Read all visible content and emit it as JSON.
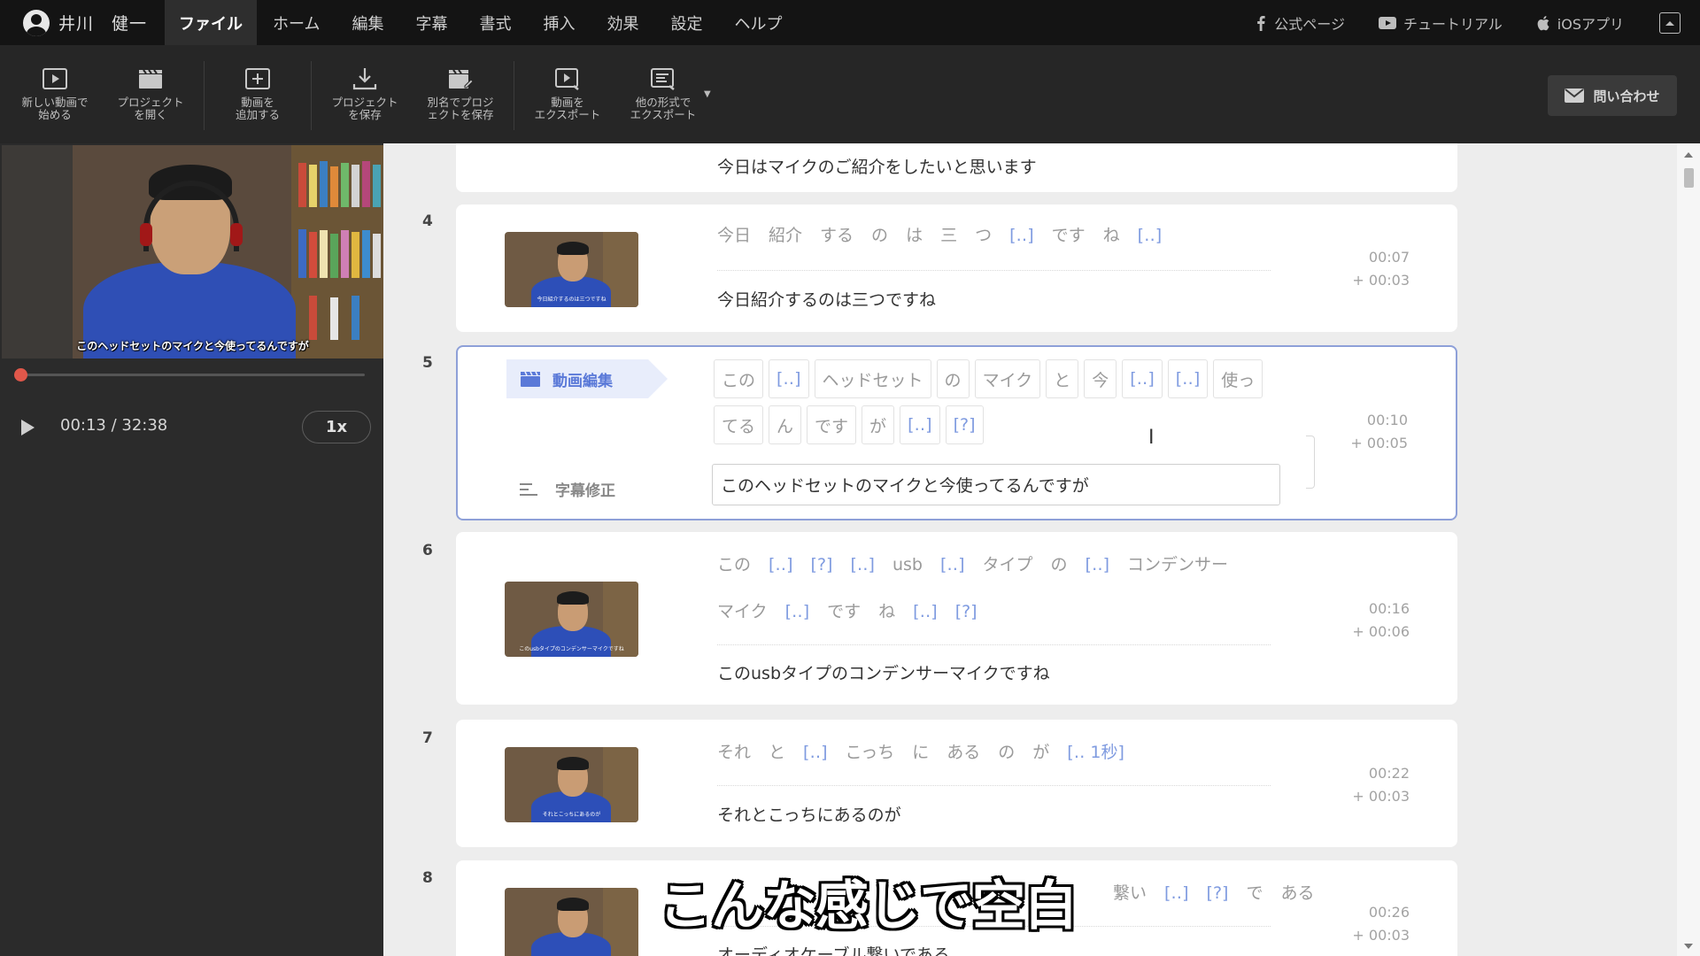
{
  "user": {
    "name": "井川　健一"
  },
  "menu": [
    "ファイル",
    "ホーム",
    "編集",
    "字幕",
    "書式",
    "挿入",
    "効果",
    "設定",
    "ヘルプ"
  ],
  "links": {
    "official": "公式ページ",
    "tutorial": "チュートリアル",
    "ios": "iOSアプリ"
  },
  "toolbar": {
    "new_video": "新しい動画で\n始める",
    "open_project": "プロジェクト\nを開く",
    "add_video": "動画を\n追加する",
    "save_project": "プロジェクト\nを保存",
    "save_as": "別名でプロジ\nェクトを保存",
    "export_video": "動画を\nエクスポート",
    "export_other": "他の形式で\nエクスポート",
    "contact": "問い合わせ"
  },
  "player": {
    "caption": "このヘッドセットのマイクと今使ってるんですが",
    "timecode": "00:13 / 32:38",
    "speed": "1x",
    "progress": 0.007
  },
  "rows": {
    "r3": {
      "subtitle": "今日はマイクのご紹介をしたいと思います"
    },
    "r4": {
      "num": "4",
      "words": [
        "今日",
        "紹介",
        "する",
        "の",
        "は",
        "三",
        "つ",
        "[‥]",
        "です",
        "ね",
        "[‥]"
      ],
      "subtitle": "今日紹介するのは三つですね",
      "time": "00:07",
      "dur": "+ 00:03",
      "thumb_caption": "今日紹介するのは三つですね"
    },
    "r5": {
      "num": "5",
      "chips1": [
        "この",
        "[‥]",
        "ヘッドセット",
        "の",
        "マイク",
        "と",
        "今",
        "[‥]",
        "[‥]",
        "使っ"
      ],
      "chips2": [
        "てる",
        "ん",
        "です",
        "が",
        "[‥]",
        "[?]"
      ],
      "edit_tag": "動画編集",
      "fix_label": "字幕修正",
      "input_value": "このヘッドセットのマイクと今使ってるんですが",
      "time": "00:10",
      "dur": "+ 00:05"
    },
    "r6": {
      "num": "6",
      "words1": [
        "この",
        "[‥]",
        "[?]",
        "[‥]",
        "usb",
        "[‥]",
        "タイプ",
        "の",
        "[‥]",
        "コンデンサー"
      ],
      "words2": [
        "マイク",
        "[‥]",
        "です",
        "ね",
        "[‥]",
        "[?]"
      ],
      "subtitle": "このusbタイプのコンデンサーマイクですね",
      "time": "00:16",
      "dur": "+ 00:06",
      "thumb_caption": "このusbタイプのコンデンサーマイクですね"
    },
    "r7": {
      "num": "7",
      "words": [
        "それ",
        "と",
        "[‥]",
        "こっち",
        "に",
        "ある",
        "の",
        "が",
        "[‥ 1秒]"
      ],
      "subtitle": "それとこっちにあるのが",
      "time": "00:22",
      "dur": "+ 00:03",
      "thumb_caption": "それとこっちにあるのが"
    },
    "r8": {
      "num": "8",
      "words": [
        "繋い",
        "[‥]",
        "[?]",
        "で",
        "ある"
      ],
      "subtitle": "オーディオケーブル繋いである",
      "time": "00:26",
      "dur": "+ 00:03"
    }
  },
  "overlay_caption": "こんな感じで空白"
}
